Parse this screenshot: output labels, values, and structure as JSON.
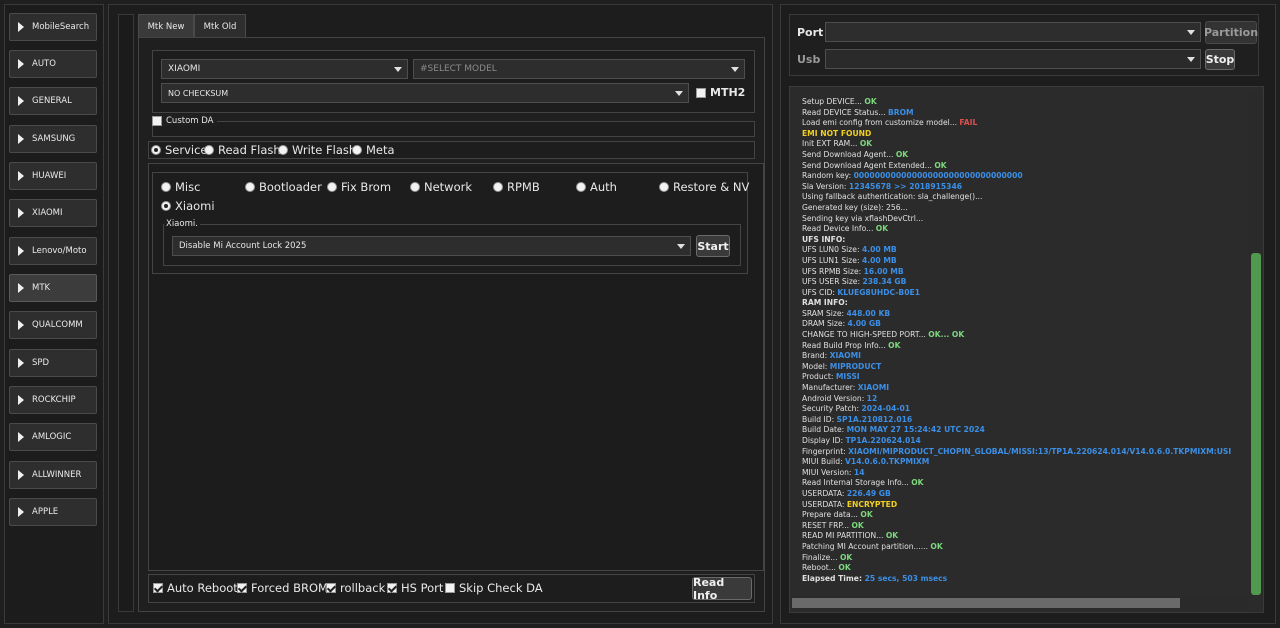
{
  "sidebar": {
    "items": [
      {
        "label": "MobileSearch"
      },
      {
        "label": "AUTO"
      },
      {
        "label": "GENERAL"
      },
      {
        "label": "SAMSUNG"
      },
      {
        "label": "HUAWEI"
      },
      {
        "label": "XIAOMI"
      },
      {
        "label": "Lenovo/Moto"
      },
      {
        "label": "MTK",
        "active": true
      },
      {
        "label": "QUALCOMM"
      },
      {
        "label": "SPD"
      },
      {
        "label": "ROCKCHIP"
      },
      {
        "label": "AMLOGIC"
      },
      {
        "label": "ALLWINNER"
      },
      {
        "label": "APPLE"
      }
    ]
  },
  "tabs": [
    {
      "label": "Mtk New",
      "active": true
    },
    {
      "label": "Mtk Old",
      "active": false
    }
  ],
  "brand_select": {
    "value": "XIAOMI"
  },
  "model_select": {
    "placeholder": "#SELECT MODEL"
  },
  "checksum_select": {
    "value": "NO CHECKSUM"
  },
  "mth2": {
    "label": "MTH2",
    "checked": false
  },
  "custom_da": {
    "label": "Custom DA",
    "checked": false
  },
  "modes": [
    {
      "label": "Service",
      "selected": true
    },
    {
      "label": "Read Flash",
      "selected": false
    },
    {
      "label": "Write Flash",
      "selected": false
    },
    {
      "label": "Meta",
      "selected": false
    }
  ],
  "functions": [
    {
      "label": "Misc",
      "selected": false
    },
    {
      "label": "Bootloader",
      "selected": false
    },
    {
      "label": "Fix Brom",
      "selected": false
    },
    {
      "label": "Network",
      "selected": false
    },
    {
      "label": "RPMB",
      "selected": false
    },
    {
      "label": "Auth",
      "selected": false
    },
    {
      "label": "Restore & NV",
      "selected": false
    },
    {
      "label": "Xiaomi",
      "selected": true
    }
  ],
  "xiaomi_group": {
    "title": "Xiaomi.",
    "operation": "Disable Mi Account Lock 2025",
    "start_label": "Start"
  },
  "options": [
    {
      "label": "Auto Reboot",
      "checked": true
    },
    {
      "label": "Forced BROM",
      "checked": true
    },
    {
      "label": "rollback",
      "checked": true
    },
    {
      "label": "HS Port",
      "checked": true
    },
    {
      "label": "Skip Check DA",
      "checked": false
    }
  ],
  "read_info_label": "Read Info",
  "connection": {
    "port_label": "Port",
    "usb_label": "Usb",
    "partition_label": "Partition",
    "stop_label": "Stop"
  },
  "colors": {
    "ok": "#7dd87d",
    "blue": "#3b8fe6",
    "fail": "#e05050",
    "yellow": "#f0d020"
  },
  "log": [
    {
      "text": "Setup DEVICE... ",
      "val": "OK",
      "color": "ok"
    },
    {
      "text": "Read DEVICE Status... ",
      "val": "BROM",
      "color": "blue"
    },
    {
      "text": "Load emi config from customize model... ",
      "val": "FAIL",
      "color": "fail"
    },
    {
      "text": "  ",
      "val": "EMI NOT FOUND",
      "color": "yellow"
    },
    {
      "text": "Init EXT RAM... ",
      "val": "OK",
      "color": "ok"
    },
    {
      "text": "Send Download Agent... ",
      "val": "OK",
      "color": "ok"
    },
    {
      "text": "Send Download Agent Extended... ",
      "val": "OK",
      "color": "ok"
    },
    {
      "text": "Random key:  ",
      "val": "00000000000000000000000000000000",
      "color": "blue"
    },
    {
      "text": "Sla Version:  ",
      "val": "12345678  >> 2018915346",
      "color": "blue"
    },
    {
      "text": "Using fallback authentication: sla_challenge()...",
      "val": "",
      "color": "ok"
    },
    {
      "text": "Generated key (size): 256...",
      "val": "",
      "color": "ok"
    },
    {
      "text": "Sending key via xflashDevCtrl...",
      "val": "",
      "color": "ok"
    },
    {
      "text": "Read Device Info... ",
      "val": "OK",
      "color": "ok"
    },
    {
      "text": "UFS INFO:",
      "val": "",
      "color": "ok",
      "bold": true
    },
    {
      "text": "UFS LUN0 Size: ",
      "val": "4.00 MB",
      "color": "blue"
    },
    {
      "text": "UFS LUN1 Size: ",
      "val": "4.00 MB",
      "color": "blue"
    },
    {
      "text": "UFS RPMB Size: ",
      "val": "16.00 MB",
      "color": "blue"
    },
    {
      "text": "UFS USER Size: ",
      "val": "238.34 GB",
      "color": "blue"
    },
    {
      "text": "UFS CID: ",
      "val": "KLUEG8UHDC-B0E1",
      "color": "blue"
    },
    {
      "text": "RAM INFO:",
      "val": "",
      "color": "ok",
      "bold": true
    },
    {
      "text": "SRAM Size: ",
      "val": "448.00 KB",
      "color": "blue"
    },
    {
      "text": "DRAM Size: ",
      "val": "4.00 GB",
      "color": "blue"
    },
    {
      "text": "CHANGE TO HIGH-SPEED PORT... ",
      "val": "OK... OK",
      "color": "ok"
    },
    {
      "text": "Read Build Prop Info... ",
      "val": "OK",
      "color": "ok"
    },
    {
      "text": " Brand: ",
      "val": "XIAOMI",
      "color": "blue"
    },
    {
      "text": " Model: ",
      "val": "MIPRODUCT",
      "color": "blue"
    },
    {
      "text": " Product: ",
      "val": "MISSI",
      "color": "blue"
    },
    {
      "text": " Manufacturer: ",
      "val": "XIAOMI",
      "color": "blue"
    },
    {
      "text": " Android Version: ",
      "val": "12",
      "color": "blue"
    },
    {
      "text": " Security Patch: ",
      "val": "2024-04-01",
      "color": "blue"
    },
    {
      "text": " Build ID: ",
      "val": "SP1A.210812.016",
      "color": "blue"
    },
    {
      "text": " Build Date: ",
      "val": "MON MAY 27 15:24:42 UTC 2024",
      "color": "blue"
    },
    {
      "text": " Display ID: ",
      "val": "TP1A.220624.014",
      "color": "blue"
    },
    {
      "text": " Fingerprint: ",
      "val": "XIAOMI/MIPRODUCT_CHOPIN_GLOBAL/MISSI:13/TP1A.220624.014/V14.0.6.0.TKPMIXM:USI",
      "color": "blue"
    },
    {
      "text": " MIUI Build: ",
      "val": "V14.0.6.0.TKPMIXM",
      "color": "blue"
    },
    {
      "text": " MIUI Version: ",
      "val": "14",
      "color": "blue"
    },
    {
      "text": "Read Internal Storage Info... ",
      "val": "OK",
      "color": "ok"
    },
    {
      "text": "USERDATA: ",
      "val": "226.49 GB",
      "color": "blue"
    },
    {
      "text": "USERDATA: ",
      "val": "ENCRYPTED",
      "color": "yellow"
    },
    {
      "text": "Prepare data... ",
      "val": "OK",
      "color": "ok"
    },
    {
      "text": "RESET FRP... ",
      "val": "OK",
      "color": "ok"
    },
    {
      "text": "READ MI PARTITION... ",
      "val": "OK",
      "color": "ok"
    },
    {
      "text": "Patching MI Account partition...... ",
      "val": "OK",
      "color": "ok"
    },
    {
      "text": "Finalize... ",
      "val": "OK",
      "color": "ok"
    },
    {
      "text": "Reboot... ",
      "val": "OK",
      "color": "ok"
    },
    {
      "text": "Elapsed Time: ",
      "val": "25 secs, 503 msecs",
      "color": "blue",
      "bold": true
    }
  ]
}
